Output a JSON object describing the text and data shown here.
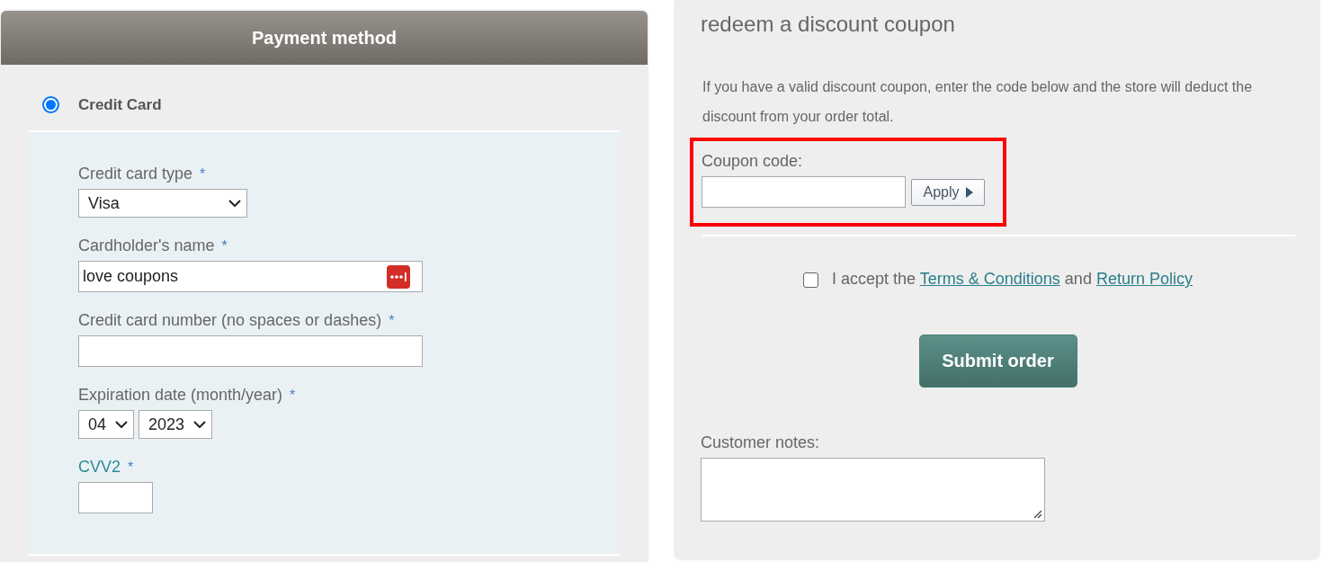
{
  "payment": {
    "title": "Payment method",
    "methods": [
      {
        "label": "Credit Card",
        "selected": true
      }
    ],
    "fields": [
      {
        "kind": "select",
        "label": "Credit card type",
        "marker": "*",
        "value": "Visa",
        "help_link": false
      },
      {
        "kind": "text",
        "label": "Cardholder's name",
        "marker": "*",
        "value": "love coupons",
        "autofill_icon": true,
        "help_link": false
      },
      {
        "kind": "text",
        "label": "Credit card number (no spaces or dashes)",
        "marker": "*",
        "autofill_icon": false,
        "help_link": false
      },
      {
        "kind": "select_pair",
        "label": "Expiration date (month/year)",
        "marker": "*",
        "selects": [
          {
            "value": "04"
          },
          {
            "value": "2023"
          }
        ],
        "help_link": false
      },
      {
        "kind": "short_text",
        "label": "CVV2",
        "marker": "*",
        "autofill_icon": false,
        "help_link": true
      }
    ]
  },
  "coupon": {
    "title": "redeem a discount coupon",
    "intro": "If you have a valid discount coupon, enter the code below and the store will deduct the discount from your order total.",
    "highlighted": true,
    "code_label": "Coupon code:",
    "apply": "Apply"
  },
  "terms": {
    "checked": false,
    "parts": [
      {
        "kind": "text",
        "text": "I accept the"
      },
      {
        "kind": "link",
        "text": "Terms & Conditions"
      },
      {
        "kind": "text",
        "text": "and"
      },
      {
        "kind": "link",
        "text": "Return Policy"
      }
    ]
  },
  "submit": "Submit order",
  "notes": {
    "label": "Customer notes:"
  }
}
